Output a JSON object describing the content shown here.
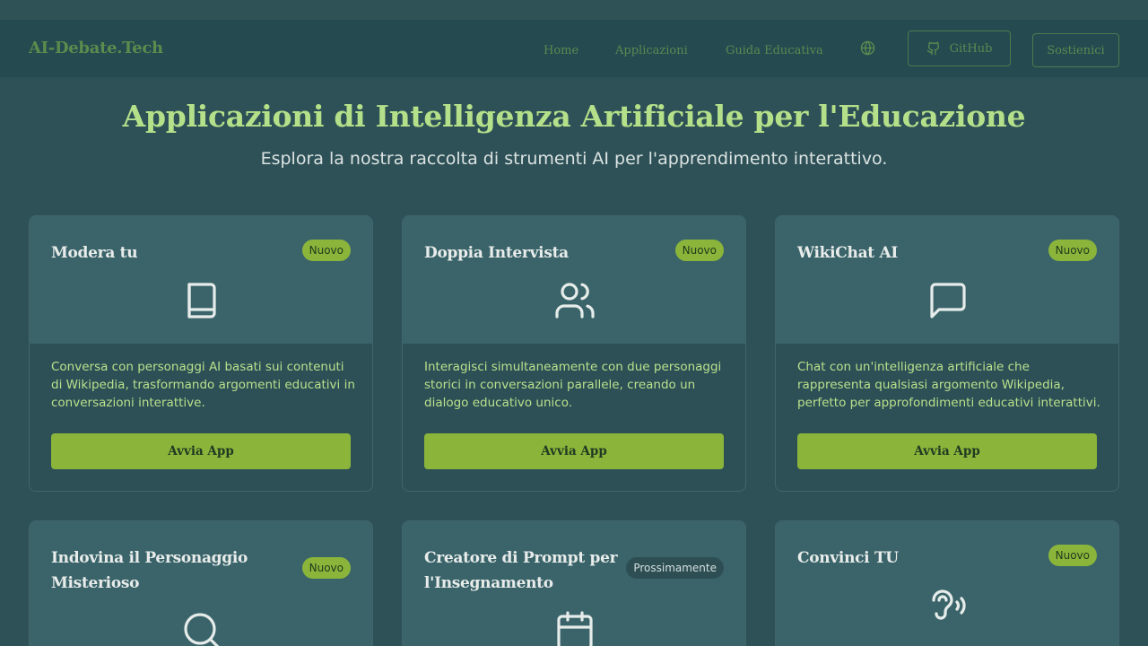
{
  "nav": {
    "brand": "AI-Debate.Tech",
    "links": [
      "Home",
      "Applicazioni",
      "Guida Educativa"
    ],
    "github_label": "GitHub",
    "support_label": "Sostienici"
  },
  "hero": {
    "title": "Applicazioni di Intelligenza Artificiale per l'Educazione",
    "subtitle": "Esplora la nostra raccolta di strumenti AI per l'apprendimento interattivo."
  },
  "cards": [
    {
      "title": "Modera tu",
      "badge": "Nuovo",
      "icon": "book-icon",
      "description": "Conversa con personaggi AI basati sui contenuti di Wikipedia, trasformando argomenti educativi in conversazioni interattive.",
      "button": "Avvia App"
    },
    {
      "title": "Doppia Intervista",
      "badge": "Nuovo",
      "icon": "users-icon",
      "description": "Interagisci simultaneamente con due personaggi storici in conversazioni parallele, creando un dialogo educativo unico.",
      "button": "Avvia App"
    },
    {
      "title": "WikiChat AI",
      "badge": "Nuovo",
      "icon": "message-square-icon",
      "description": "Chat con un'intelligenza artificiale che rappresenta qualsiasi argomento Wikipedia, perfetto per approfondimenti educativi interattivi.",
      "button": "Avvia App"
    },
    {
      "title": "Indovina il Personaggio Misterioso",
      "badge": "Nuovo",
      "icon": "search-icon"
    },
    {
      "title": "Creatore di Prompt per l'Insegnamento",
      "badge": "Prossimamente",
      "icon": "calendar-icon"
    },
    {
      "title": "Convinci TU",
      "badge": "Nuovo",
      "icon": "ear-speech-icon"
    }
  ],
  "colors": {
    "background": "#2e5157",
    "accent": "#8bb53a",
    "title_green": "#b5e08a",
    "card_header": "#3a646a"
  }
}
